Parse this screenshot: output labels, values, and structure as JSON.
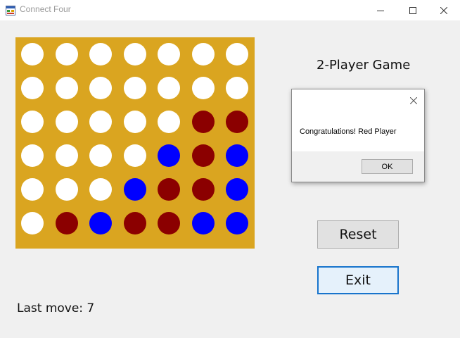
{
  "window": {
    "title": "Connect Four",
    "app_icon": "winforms-app-icon",
    "controls": [
      "minimize-icon",
      "maximize-icon",
      "close-icon"
    ]
  },
  "game": {
    "mode_label": "2-Player Game",
    "last_move": "Last move: 7",
    "reset_label": "Reset",
    "exit_label": "Exit"
  },
  "board": {
    "columns": 7,
    "rows": 6,
    "colors": {
      "board": "#daa520",
      "empty": "#ffffff",
      "red": "#8b0000",
      "blue": "#0000ff"
    },
    "cells": [
      [
        "empty",
        "empty",
        "empty",
        "empty",
        "empty",
        "empty",
        "empty"
      ],
      [
        "empty",
        "empty",
        "empty",
        "empty",
        "empty",
        "empty",
        "empty"
      ],
      [
        "empty",
        "empty",
        "empty",
        "empty",
        "empty",
        "red",
        "red"
      ],
      [
        "empty",
        "empty",
        "empty",
        "empty",
        "blue",
        "red",
        "blue"
      ],
      [
        "empty",
        "empty",
        "empty",
        "blue",
        "red",
        "red",
        "blue"
      ],
      [
        "empty",
        "red",
        "blue",
        "red",
        "red",
        "blue",
        "blue"
      ]
    ]
  },
  "dialog": {
    "message": "Congratulations! Red Player",
    "ok_label": "OK"
  }
}
